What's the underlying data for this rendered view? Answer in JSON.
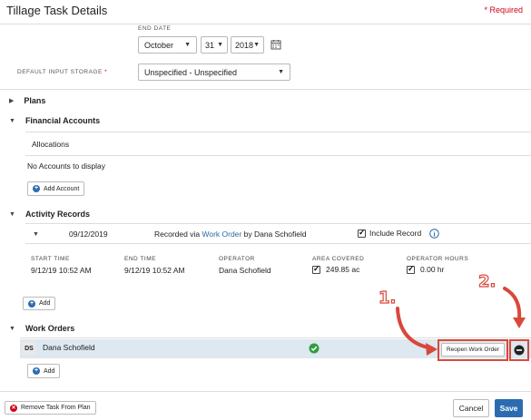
{
  "header": {
    "title": "Tillage Task Details",
    "required": "* Required"
  },
  "end_date": {
    "label": "END DATE",
    "month": "October",
    "day": "31",
    "year": "2018"
  },
  "storage": {
    "label": "DEFAULT INPUT STORAGE",
    "required_mark": "*",
    "value": "Unspecified - Unspecified"
  },
  "plans": {
    "label": "Plans"
  },
  "financial": {
    "label": "Financial Accounts",
    "allocations": "Allocations",
    "empty": "No Accounts to display",
    "add_label": "Add Account"
  },
  "activity": {
    "label": "Activity Records",
    "record": {
      "date": "09/12/2019",
      "recorded_prefix": "Recorded via",
      "recorded_link": "Work Order",
      "recorded_suffix": "by Dana Schofield",
      "include_label": "Include Record",
      "headers": [
        "START TIME",
        "END TIME",
        "OPERATOR",
        "AREA COVERED",
        "OPERATOR HOURS"
      ],
      "start": "9/12/19 10:52 AM",
      "end": "9/12/19 10:52 AM",
      "operator": "Dana Schofield",
      "area": "249.85 ac",
      "hours": "0.00 hr"
    },
    "add_label": "Add"
  },
  "work_orders": {
    "label": "Work Orders",
    "row": {
      "initials": "DS",
      "name": "Dana Schofield",
      "reopen_label": "Reopen Work Order"
    },
    "add_label": "Add"
  },
  "annotations": {
    "one": "1.",
    "two": "2."
  },
  "footer": {
    "remove_label": "Remove Task From Plan",
    "cancel_label": "Cancel",
    "save_label": "Save"
  },
  "colors": {
    "accent": "#2a6aa8",
    "required": "#d0021b",
    "annotation": "#d9483b",
    "success": "#2e9e3e",
    "save": "#2b6cb0"
  }
}
